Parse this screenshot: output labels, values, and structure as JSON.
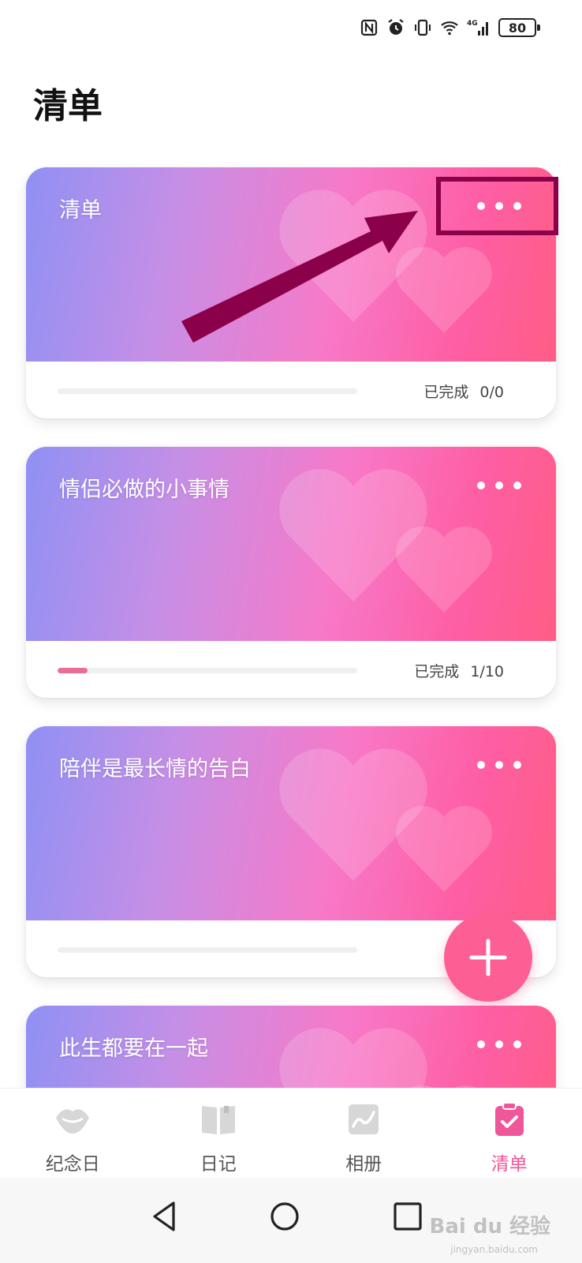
{
  "status_bar": {
    "battery": "80",
    "network": "4G"
  },
  "page": {
    "title": "清单"
  },
  "lists": [
    {
      "title": "清单",
      "progress_label": "已完成",
      "count": "0/0",
      "progress": 0.0
    },
    {
      "title": "情侣必做的小事情",
      "progress_label": "已完成",
      "count": "1/10",
      "progress": 0.1
    },
    {
      "title": "陪伴是最长情的告白",
      "progress_label": "已完成",
      "count": "",
      "progress": 0.0
    },
    {
      "title": "此生都要在一起",
      "progress_label": "",
      "count": "",
      "progress": 0.0
    }
  ],
  "bottom_nav": {
    "items": [
      {
        "label": "纪念日",
        "icon": "lips-icon"
      },
      {
        "label": "日记",
        "icon": "book-icon"
      },
      {
        "label": "相册",
        "icon": "photo-icon"
      },
      {
        "label": "清单",
        "icon": "clipboard-check-icon"
      }
    ],
    "active_index": 3
  },
  "watermark": {
    "text": "Bai du 经验",
    "sub": "jingyan.baidu.com"
  },
  "colors": {
    "accent": "#f0579a",
    "fab": "#fd5f95",
    "annotation": "#8a0049"
  }
}
